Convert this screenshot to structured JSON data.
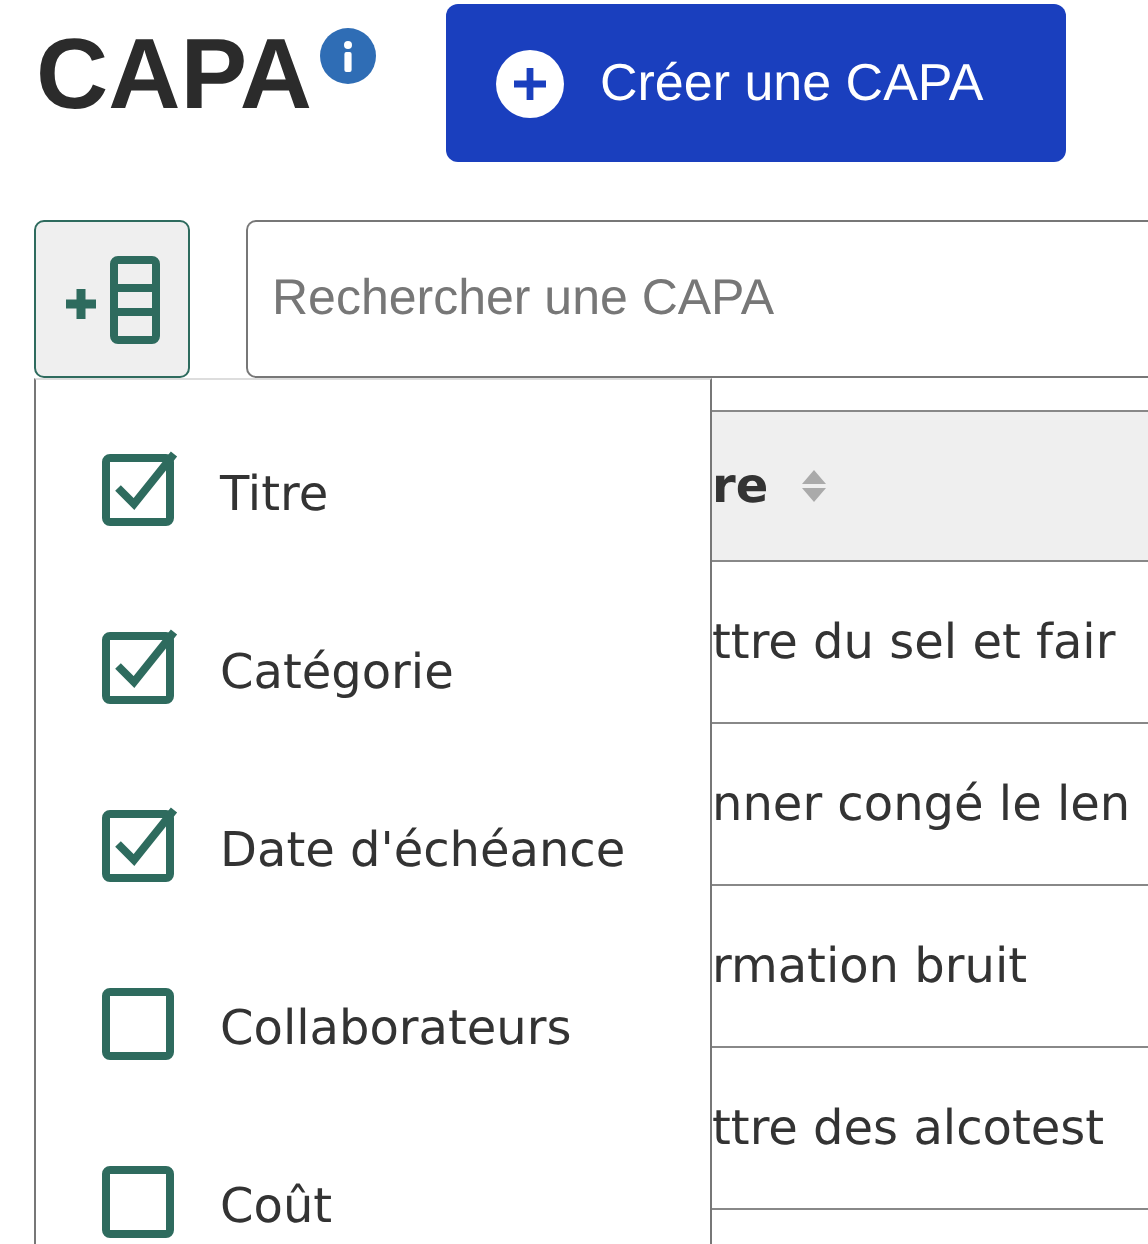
{
  "header": {
    "title": "CAPA",
    "create_button": "Créer une CAPA"
  },
  "search": {
    "placeholder": "Rechercher une CAPA"
  },
  "column_menu": [
    {
      "label": "Titre",
      "checked": true
    },
    {
      "label": "Catégorie",
      "checked": true
    },
    {
      "label": "Date d'échéance",
      "checked": true
    },
    {
      "label": "Collaborateurs",
      "checked": false
    },
    {
      "label": "Coût",
      "checked": false
    }
  ],
  "table": {
    "columns": [
      "re"
    ],
    "rows": [
      "ttre du sel et fair",
      "nner congé le len",
      "rmation bruit",
      "ttre des alcotest"
    ]
  }
}
